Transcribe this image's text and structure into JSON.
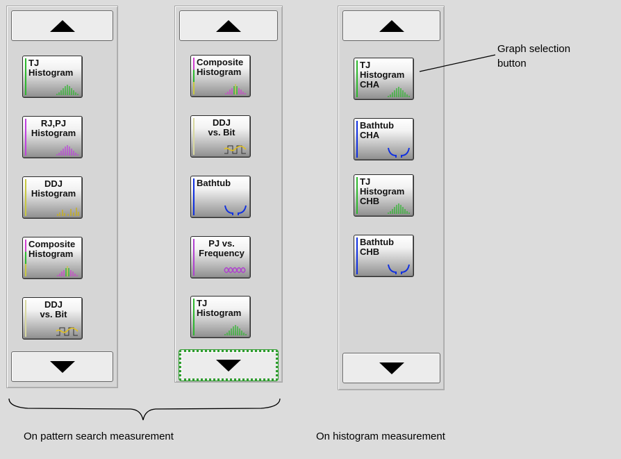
{
  "colors": {
    "tj": "#2db82d",
    "rjpj": "#c040e0",
    "ddj": "#c8c840",
    "composite": "#d040d0",
    "bathtub": "#1030e0",
    "pj": "#b040d0"
  },
  "left_panel": {
    "buttons": [
      {
        "label": "TJ\nHistogram",
        "align": "left",
        "icon": "tj-histogram-icon"
      },
      {
        "label": "RJ,PJ\nHistogram",
        "align": "center",
        "icon": "rjpj-histogram-icon"
      },
      {
        "label": "DDJ\nHistogram",
        "align": "center",
        "icon": "ddj-histogram-icon"
      },
      {
        "label": "Composite\nHistogram",
        "align": "left",
        "icon": "composite-histogram-icon"
      },
      {
        "label": "DDJ\nvs. Bit",
        "align": "center",
        "icon": "ddj-vs-bit-icon"
      }
    ]
  },
  "middle_panel": {
    "buttons": [
      {
        "label": "Composite\nHistogram",
        "align": "left",
        "icon": "composite-histogram-icon"
      },
      {
        "label": "DDJ\nvs. Bit",
        "align": "center",
        "icon": "ddj-vs-bit-icon"
      },
      {
        "label": "Bathtub",
        "align": "left",
        "icon": "bathtub-icon"
      },
      {
        "label": "PJ vs.\nFrequency",
        "align": "center",
        "icon": "pj-vs-frequency-icon"
      },
      {
        "label": "TJ\nHistogram",
        "align": "left",
        "icon": "tj-histogram-icon"
      }
    ]
  },
  "right_panel": {
    "buttons": [
      {
        "label": "TJ\nHistogram\nCHA",
        "align": "left",
        "icon": "tj-histogram-icon"
      },
      {
        "label": "Bathtub\nCHA",
        "align": "left",
        "icon": "bathtub-icon"
      },
      {
        "label": "TJ\nHistogram\nCHB",
        "align": "left",
        "icon": "tj-histogram-icon"
      },
      {
        "label": "Bathtub\nCHB",
        "align": "left",
        "icon": "bathtub-icon"
      }
    ]
  },
  "annotations": {
    "callout": "Graph selection\nbutton",
    "caption_left": "On pattern search measurement",
    "caption_right": "On histogram measurement"
  }
}
